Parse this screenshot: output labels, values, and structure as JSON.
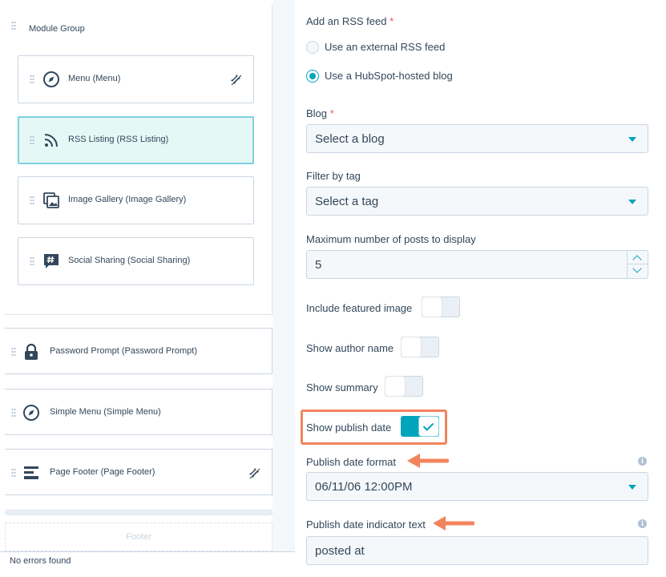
{
  "left_panel": {
    "group_title": "Module Group",
    "modules": [
      {
        "label": "Menu (Menu)",
        "icon": "compass-icon",
        "pinned": true
      },
      {
        "label": "RSS Listing (RSS Listing)",
        "icon": "rss-icon",
        "selected": true
      },
      {
        "label": "Image Gallery (Image Gallery)",
        "icon": "image-gallery-icon"
      },
      {
        "label": "Social Sharing (Social Sharing)",
        "icon": "hashtag-icon"
      }
    ],
    "rows": [
      {
        "label": "Password Prompt (Password Prompt)",
        "icon": "lock-icon"
      },
      {
        "label": "Simple Menu (Simple Menu)",
        "icon": "compass-icon"
      },
      {
        "label": "Page Footer (Page Footer)",
        "icon": "footer-icon",
        "pinned": true
      }
    ],
    "footer_drop": "Footer",
    "status": "No errors found"
  },
  "form": {
    "rss_feed": {
      "label": "Add an RSS feed",
      "required": "*",
      "options": [
        "Use an external RSS feed",
        "Use a HubSpot-hosted blog"
      ],
      "selected": "Use a HubSpot-hosted blog"
    },
    "blog": {
      "label": "Blog",
      "required": "*",
      "value": "Select a blog"
    },
    "filter_by_tag": {
      "label": "Filter by tag",
      "value": "Select a tag"
    },
    "max_posts": {
      "label": "Maximum number of posts to display",
      "value": "5"
    },
    "include_featured_image": {
      "label": "Include featured image",
      "on": false
    },
    "show_author_name": {
      "label": "Show author name",
      "on": false
    },
    "show_summary": {
      "label": "Show summary",
      "on": false
    },
    "show_publish_date": {
      "label": "Show publish date",
      "on": true
    },
    "publish_date_format": {
      "label": "Publish date format",
      "value": "06/11/06 12:00PM"
    },
    "publish_date_indicator": {
      "label": "Publish date indicator text",
      "value": "posted at"
    }
  },
  "colors": {
    "accent": "#00a4bd",
    "annotation": "#f2845d",
    "text": "#33475b",
    "required": "#f2545b"
  }
}
